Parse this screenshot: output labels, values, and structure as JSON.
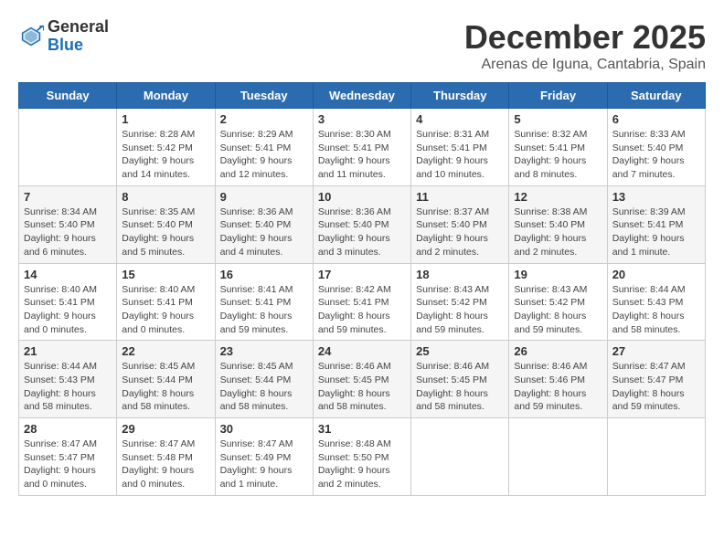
{
  "header": {
    "logo_general": "General",
    "logo_blue": "Blue",
    "title": "December 2025",
    "subtitle": "Arenas de Iguna, Cantabria, Spain"
  },
  "days_of_week": [
    "Sunday",
    "Monday",
    "Tuesday",
    "Wednesday",
    "Thursday",
    "Friday",
    "Saturday"
  ],
  "weeks": [
    [
      {
        "day": "",
        "sunrise": "",
        "sunset": "",
        "daylight": ""
      },
      {
        "day": "1",
        "sunrise": "Sunrise: 8:28 AM",
        "sunset": "Sunset: 5:42 PM",
        "daylight": "Daylight: 9 hours and 14 minutes."
      },
      {
        "day": "2",
        "sunrise": "Sunrise: 8:29 AM",
        "sunset": "Sunset: 5:41 PM",
        "daylight": "Daylight: 9 hours and 12 minutes."
      },
      {
        "day": "3",
        "sunrise": "Sunrise: 8:30 AM",
        "sunset": "Sunset: 5:41 PM",
        "daylight": "Daylight: 9 hours and 11 minutes."
      },
      {
        "day": "4",
        "sunrise": "Sunrise: 8:31 AM",
        "sunset": "Sunset: 5:41 PM",
        "daylight": "Daylight: 9 hours and 10 minutes."
      },
      {
        "day": "5",
        "sunrise": "Sunrise: 8:32 AM",
        "sunset": "Sunset: 5:41 PM",
        "daylight": "Daylight: 9 hours and 8 minutes."
      },
      {
        "day": "6",
        "sunrise": "Sunrise: 8:33 AM",
        "sunset": "Sunset: 5:40 PM",
        "daylight": "Daylight: 9 hours and 7 minutes."
      }
    ],
    [
      {
        "day": "7",
        "sunrise": "Sunrise: 8:34 AM",
        "sunset": "Sunset: 5:40 PM",
        "daylight": "Daylight: 9 hours and 6 minutes."
      },
      {
        "day": "8",
        "sunrise": "Sunrise: 8:35 AM",
        "sunset": "Sunset: 5:40 PM",
        "daylight": "Daylight: 9 hours and 5 minutes."
      },
      {
        "day": "9",
        "sunrise": "Sunrise: 8:36 AM",
        "sunset": "Sunset: 5:40 PM",
        "daylight": "Daylight: 9 hours and 4 minutes."
      },
      {
        "day": "10",
        "sunrise": "Sunrise: 8:36 AM",
        "sunset": "Sunset: 5:40 PM",
        "daylight": "Daylight: 9 hours and 3 minutes."
      },
      {
        "day": "11",
        "sunrise": "Sunrise: 8:37 AM",
        "sunset": "Sunset: 5:40 PM",
        "daylight": "Daylight: 9 hours and 2 minutes."
      },
      {
        "day": "12",
        "sunrise": "Sunrise: 8:38 AM",
        "sunset": "Sunset: 5:40 PM",
        "daylight": "Daylight: 9 hours and 2 minutes."
      },
      {
        "day": "13",
        "sunrise": "Sunrise: 8:39 AM",
        "sunset": "Sunset: 5:41 PM",
        "daylight": "Daylight: 9 hours and 1 minute."
      }
    ],
    [
      {
        "day": "14",
        "sunrise": "Sunrise: 8:40 AM",
        "sunset": "Sunset: 5:41 PM",
        "daylight": "Daylight: 9 hours and 0 minutes."
      },
      {
        "day": "15",
        "sunrise": "Sunrise: 8:40 AM",
        "sunset": "Sunset: 5:41 PM",
        "daylight": "Daylight: 9 hours and 0 minutes."
      },
      {
        "day": "16",
        "sunrise": "Sunrise: 8:41 AM",
        "sunset": "Sunset: 5:41 PM",
        "daylight": "Daylight: 8 hours and 59 minutes."
      },
      {
        "day": "17",
        "sunrise": "Sunrise: 8:42 AM",
        "sunset": "Sunset: 5:41 PM",
        "daylight": "Daylight: 8 hours and 59 minutes."
      },
      {
        "day": "18",
        "sunrise": "Sunrise: 8:43 AM",
        "sunset": "Sunset: 5:42 PM",
        "daylight": "Daylight: 8 hours and 59 minutes."
      },
      {
        "day": "19",
        "sunrise": "Sunrise: 8:43 AM",
        "sunset": "Sunset: 5:42 PM",
        "daylight": "Daylight: 8 hours and 59 minutes."
      },
      {
        "day": "20",
        "sunrise": "Sunrise: 8:44 AM",
        "sunset": "Sunset: 5:43 PM",
        "daylight": "Daylight: 8 hours and 58 minutes."
      }
    ],
    [
      {
        "day": "21",
        "sunrise": "Sunrise: 8:44 AM",
        "sunset": "Sunset: 5:43 PM",
        "daylight": "Daylight: 8 hours and 58 minutes."
      },
      {
        "day": "22",
        "sunrise": "Sunrise: 8:45 AM",
        "sunset": "Sunset: 5:44 PM",
        "daylight": "Daylight: 8 hours and 58 minutes."
      },
      {
        "day": "23",
        "sunrise": "Sunrise: 8:45 AM",
        "sunset": "Sunset: 5:44 PM",
        "daylight": "Daylight: 8 hours and 58 minutes."
      },
      {
        "day": "24",
        "sunrise": "Sunrise: 8:46 AM",
        "sunset": "Sunset: 5:45 PM",
        "daylight": "Daylight: 8 hours and 58 minutes."
      },
      {
        "day": "25",
        "sunrise": "Sunrise: 8:46 AM",
        "sunset": "Sunset: 5:45 PM",
        "daylight": "Daylight: 8 hours and 58 minutes."
      },
      {
        "day": "26",
        "sunrise": "Sunrise: 8:46 AM",
        "sunset": "Sunset: 5:46 PM",
        "daylight": "Daylight: 8 hours and 59 minutes."
      },
      {
        "day": "27",
        "sunrise": "Sunrise: 8:47 AM",
        "sunset": "Sunset: 5:47 PM",
        "daylight": "Daylight: 8 hours and 59 minutes."
      }
    ],
    [
      {
        "day": "28",
        "sunrise": "Sunrise: 8:47 AM",
        "sunset": "Sunset: 5:47 PM",
        "daylight": "Daylight: 9 hours and 0 minutes."
      },
      {
        "day": "29",
        "sunrise": "Sunrise: 8:47 AM",
        "sunset": "Sunset: 5:48 PM",
        "daylight": "Daylight: 9 hours and 0 minutes."
      },
      {
        "day": "30",
        "sunrise": "Sunrise: 8:47 AM",
        "sunset": "Sunset: 5:49 PM",
        "daylight": "Daylight: 9 hours and 1 minute."
      },
      {
        "day": "31",
        "sunrise": "Sunrise: 8:48 AM",
        "sunset": "Sunset: 5:50 PM",
        "daylight": "Daylight: 9 hours and 2 minutes."
      },
      {
        "day": "",
        "sunrise": "",
        "sunset": "",
        "daylight": ""
      },
      {
        "day": "",
        "sunrise": "",
        "sunset": "",
        "daylight": ""
      },
      {
        "day": "",
        "sunrise": "",
        "sunset": "",
        "daylight": ""
      }
    ]
  ]
}
